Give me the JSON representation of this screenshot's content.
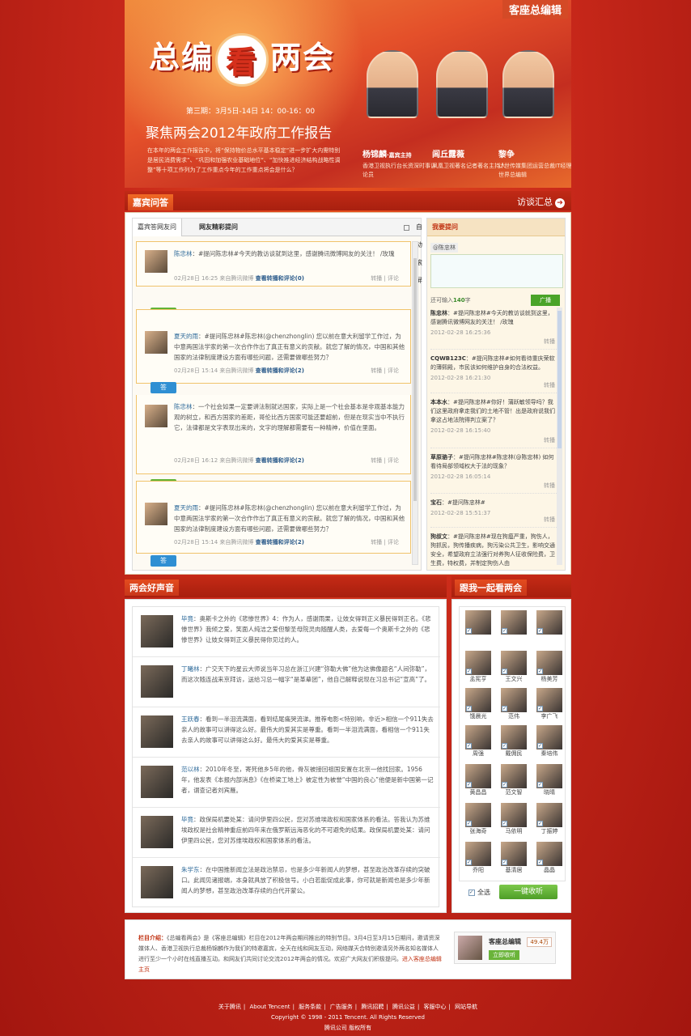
{
  "banner": {
    "brand_tag": "客座总编辑",
    "logo_left": "总编",
    "logo_mid": "看",
    "logo_right": "两会",
    "period": "第三期：3月5日-14日 14：00-16：00",
    "headline": "聚焦两会2012年政府工作报告",
    "intro": "在本年的两会工作报告中，将“保持物价总水平基本稳定”进一步扩大内需特别是居民消费需求”、“巩固和加强农业基础地位”、“加快推进经济结构战略性调整”等十项工作列为了工作重点今年的工作重点将会是什么？",
    "guests": [
      {
        "name": "杨锦麟",
        "role": "·嘉宾主持",
        "desc": "香港卫视执行台长资深时事评论员"
      },
      {
        "name": "闾丘露薇",
        "role": "",
        "desc": "凤凰卫视著名记者著名主持人"
      },
      {
        "name": "黎争",
        "role": "",
        "desc": "计世传媒集团运营总裁IT经理世界总编辑"
      }
    ]
  },
  "qa_ribbon": {
    "title": "嘉宾问答",
    "more": "访谈汇总",
    "arrow": "➔"
  },
  "qa": {
    "tab_guest": "嘉宾答网友问",
    "tab_netizen": "网友精彩提问",
    "auto_scroll": "自动滚屏",
    "ask_badge": "问",
    "answer_badge": "答",
    "cards": [
      {
        "author": "陈忠林",
        "text": "：#提问陈忠林#今天的教访谈就到这里，感谢腾讯微博网友的关注！ /玫瑰",
        "time": "02月28日 16:25 来自腾讯微博",
        "link": "查看转播和评论(0)",
        "repost": "转播",
        "comment": "评论"
      },
      {
        "author": "夏天的雨",
        "text": "：#提问陈忠林#陈忠林(@chenzhonglin) 您以前在意大利留学工作过，为中意两国法学家的第一次合作作出了真正有意义的贡献。就您了解的情况，中国和其他国家的法律制度建设方面有哪些问题，还需要做哪些努力？",
        "time": "02月28日 15:14 来自腾讯微博",
        "link": "查看转播和评论(2)",
        "repost": "转播",
        "comment": "评论"
      },
      {
        "author": "陈忠林",
        "text": "：一个社会如果一定要讲法制就达国家，实际上是一个社会基本是非观基本能力观的树立，和西方国家的差距，哥伦比西方国家可能还要超前，但是在现实当中不执行它，法律都是文字表现出来的，文字的理解都需要有一种精神，价值在里面。",
        "time": "02月28日 16:12 来自腾讯微博",
        "link": "查看转播和评论(2)",
        "repost": "转播",
        "comment": "评论"
      },
      {
        "author": "夏天的雨",
        "text": "：#提问陈忠林#陈忠林(@chenzhonglin) 您以前在意大利留学工作过，为中意两国法学家的第一次合作作出了真正有意义的贡献。就您了解的情况，中国和其他国家的法律制度建设方面有哪些问题，还需要做哪些努力？",
        "time": "02月28日 15:14 来自腾讯微博",
        "link": "查看转播和评论(2)",
        "repost": "转播",
        "comment": "评论"
      }
    ],
    "ask": {
      "title": "我要提问",
      "mention": "@陈忠林",
      "count_prefix": "还可输入",
      "count": "140",
      "count_suffix": "字",
      "submit": "广播"
    },
    "questions": [
      {
        "author": "陈忠林",
        "text": "：#提问陈忠林#今天的教访谈就到这里，感谢腾讯微博网友的关注！ /玫瑰",
        "time": "2012-02-28 16:25:36",
        "repost": "转播"
      },
      {
        "author": "CQWB123C",
        "text": "：#提问陈忠林#如何看待重庆荣软的薄熙殿，市民该如何维护自身的合法权益。",
        "time": "2012-02-28 16:21:30",
        "repost": "转播"
      },
      {
        "author": "本本水",
        "text": "：#提问陈忠林#你好！蒲跃敏领导吗？我们这里政府拿走我们的土地不管！出是政府说我们拿这占地法院得判立案了？",
        "time": "2012-02-28 16:15:40",
        "repost": "转播"
      },
      {
        "author": "草原骆子",
        "text": "：#提问陈忠林#陈忠林(@陈忠林) 如何看待局部领域权大于法的现象？",
        "time": "2012-02-28 16:05:14",
        "repost": "转播"
      },
      {
        "author": "宝石",
        "text": "：#提问陈忠林#",
        "time": "2012-02-28 15:51:37",
        "repost": "转播"
      },
      {
        "author": "狗叔文",
        "text": "：#提问陈忠林#现在狗瘟严重，狗伤人，狗抓民，狗传播疾病，狗污染公共卫生，影响交通安全，希望政府立法强行对养狗人征收保险费，卫生费，特权费，并制定狗伤人由",
        "time": "",
        "repost": ""
      }
    ]
  },
  "voices": {
    "title": "两会好声音",
    "items": [
      {
        "author": "毕竟",
        "text": "：奥斯卡之外的《悲惨世界》4：作为人，感谢雨果，让妓女得到正义暴民得到正名。《悲惨世界》我倾之爱，笑面人纯洁之爱但黎圣母院灵肉随醒人类，去爱每一个奥斯卡之外的《悲惨世界》让妓女得到正义暴民得你见过的人。"
      },
      {
        "author": "丁曦林",
        "text": "：广交天下的星云大师说当年习总在浙江兴建“弥勒大佛”他为这佛像题名“人间弥勒”，而这次随连战来京拜访，送给习总一幅字“是革辈团”，他自己解释说现在习总书记“宣高”了。"
      },
      {
        "author": "王跃春",
        "text": "：看到一半泪流满面，看到结尾痛哭流涕。推荐电影<特别响，非近>相信一个911失去亲人的故事可以讲得这么好。最伟大的爱其实是尊重。看到一半泪流满面，看相信一个911失去亲人的故事可以讲得这么好。最伟大的爱其实是尊重。"
      },
      {
        "author": "范以林",
        "text": "：2010年冬至，寄死他乡5年的他，骨灰被接回祖国安置在北京一他找回家。1956年，他发表《本报内部消息》《在桥梁工地上》被定性为被誉“中国的良心”他便是新中国第一记者，谓查记者刘宾雁。"
      },
      {
        "author": "毕竟",
        "text": "：政保局机要处某：请问伊里四公民，您对苏维埃政权和国家体系的看法。答我认为苏维埃政权是社会精神重症前四年来在俄罗斯远海恶化的不可避免的结果。政保局机要处某：请问伊里四公民，您对苏维埃政权和国家体系的看法。"
      },
      {
        "author": "朱学东",
        "text": "：在中国推新闻立法是政治禁忌，也是多少年新闻人的梦想，甚至政治改革存续的突破口。此闻见诸报端，本身就具放了积极信号。小白若能促成此事，你可就是新闻也是多少年新闻人的梦想，甚至政治改革存续的白代开蒙公。"
      }
    ]
  },
  "follow": {
    "title": "跟我一起看两会",
    "check": "✓",
    "people": [
      "",
      "",
      "",
      "孟宪亨",
      "王文兴",
      "杨美芳",
      "饿晨光",
      "范伟",
      "李广飞",
      "周强",
      "戴佣民",
      "秦培伟",
      "黄昌昌",
      "范文智",
      "晓晴",
      "张海奇",
      "马依明",
      "丁振婷",
      "乔阳",
      "基清居",
      "晶晶"
    ],
    "select_all": "全选",
    "submit": "一键收听"
  },
  "column": {
    "label": "栏目介绍：",
    "text": "《总编看两会》是《客座总编辑》栏目在2012年两会期间推出的特别节目。3月4日至3月15日期间，邀请资深媒体人、香港卫视执行总裁杨锦麟作为我们的特邀嘉宾，全天在线和网友互动，网络媒天合特别邀请另外两名知名媒体人进行至少一个小时在线直播互动。和网友们共同讨论交流2012年两会的情况。欢迎广大网友们积极提问。",
    "link": "进入客座总编辑主页",
    "weibo_name": "客座总编辑",
    "weibo_count": "49.4万",
    "weibo_follow": "立即收听"
  },
  "footer": {
    "links": [
      "关于腾讯",
      "About Tencent",
      "服务条款",
      "广告服务",
      "腾讯招聘",
      "腾讯公益",
      "客服中心",
      "网站导航"
    ],
    "sep": "|",
    "copyright": "Copyright © 1998 - 2011 Tencent. All Rights Reserved",
    "company": "腾讯公司 版权所有"
  }
}
